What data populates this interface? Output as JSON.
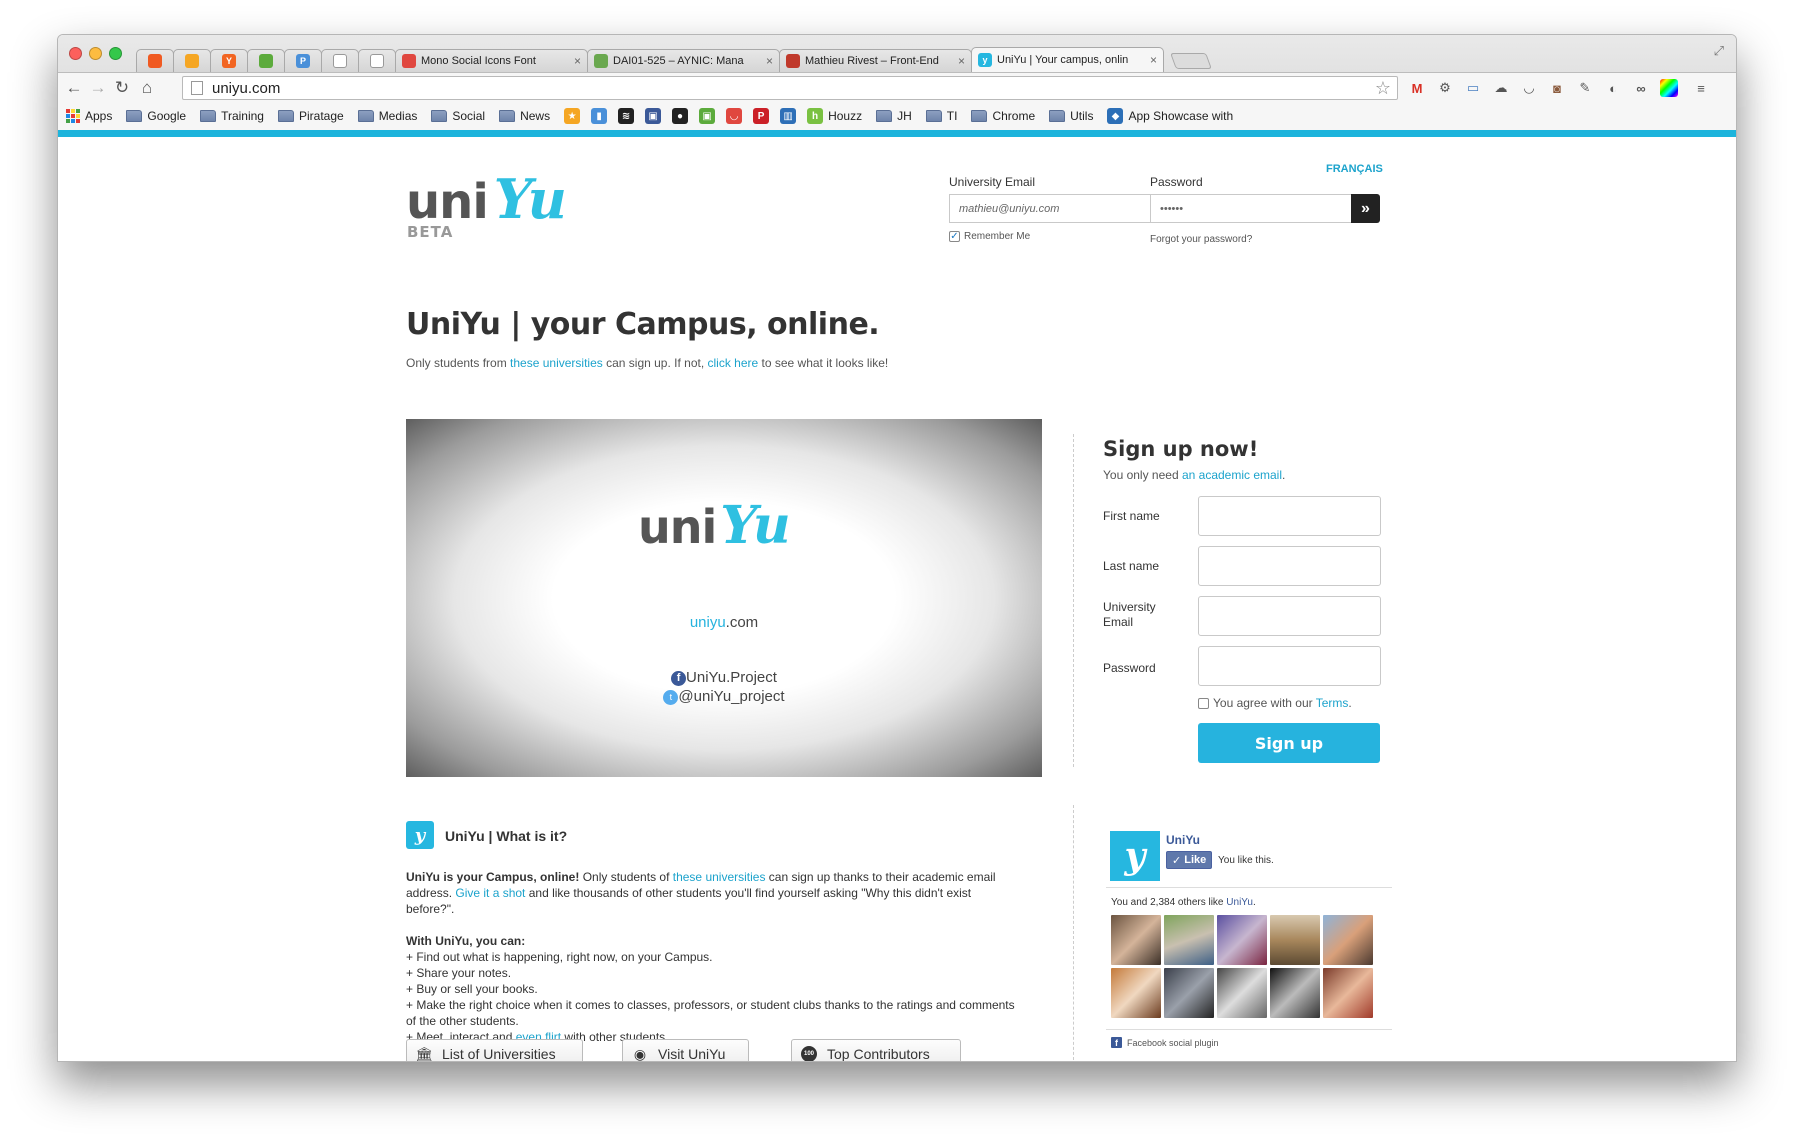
{
  "browser": {
    "tabs": [
      {
        "title": "",
        "favicon_color": "#f05a22",
        "favicon_glyph": ""
      },
      {
        "title": "",
        "favicon_color": "#f5a623",
        "favicon_glyph": ""
      },
      {
        "title": "",
        "favicon_color": "#f26522",
        "favicon_glyph": "Y"
      },
      {
        "title": "",
        "favicon_color": "#5cab3c",
        "favicon_glyph": ""
      },
      {
        "title": "",
        "favicon_color": "#4a90d9",
        "favicon_glyph": "P"
      },
      {
        "title": "",
        "favicon_color": "#ffffff",
        "favicon_glyph": ""
      },
      {
        "title": "",
        "favicon_color": "#ffffff",
        "favicon_glyph": ""
      },
      {
        "title": "Mono Social Icons Font",
        "favicon_color": "#e0473f",
        "favicon_glyph": ""
      },
      {
        "title": "DAI01-525 – AYNIC: Mana",
        "favicon_color": "#6aa84f",
        "favicon_glyph": ""
      },
      {
        "title": "Mathieu Rivest – Front-End",
        "favicon_color": "#c0392b",
        "favicon_glyph": ""
      },
      {
        "title": "UniYu | Your campus, onlin",
        "favicon_color": "#26b7e0",
        "favicon_glyph": "y"
      }
    ],
    "url": "uniyu.com",
    "bookmarks": {
      "apps": "Apps",
      "folders1": [
        "Google",
        "Training",
        "Piratage",
        "Medias",
        "Social",
        "News"
      ],
      "houzz": "Houzz",
      "folders2": [
        "JH",
        "TI",
        "Chrome",
        "Utils"
      ],
      "showcase": "App Showcase with"
    }
  },
  "header": {
    "logo_uni": "uni",
    "logo_yu": "Yu",
    "logo_beta": "BETA",
    "language_link": "FRANÇAIS",
    "login": {
      "email_label": "University Email",
      "email_value": "mathieu@uniyu.com",
      "password_label": "Password",
      "password_value": "••••••",
      "submit_icon": "»",
      "remember_label": "Remember Me",
      "forgot_link": "Forgot your password?"
    }
  },
  "hero": {
    "title": "UniYu | your Campus, online.",
    "subtitle_1": "Only students from ",
    "subtitle_link_1": "these universities",
    "subtitle_2": " can sign up. If not, ",
    "subtitle_link_2": "click here",
    "subtitle_3": " to see what it looks like!"
  },
  "video": {
    "logo_uni": "uni",
    "logo_yu": "Yu",
    "site_a": "uniyu",
    "site_b": ".com",
    "facebook": "UniYu.Project",
    "twitter": "@uniYu_project"
  },
  "signup": {
    "title": "Sign up now!",
    "sub_1": "You only need ",
    "sub_link": "an academic email",
    "sub_2": ".",
    "first_name_label": "First name",
    "last_name_label": "Last name",
    "email_label_1": "University",
    "email_label_2": "Email",
    "password_label": "Password",
    "agree_1": "You agree with our ",
    "agree_link": "Terms",
    "agree_2": ".",
    "button": "Sign up"
  },
  "about": {
    "icon": "y",
    "title": "UniYu | What is it?",
    "p1_bold": "UniYu is your Campus, online!",
    "p1_a": " Only students of ",
    "p1_link1": "these universities",
    "p1_b": " can sign up thanks to their academic email address. ",
    "p1_link2": "Give it a shot",
    "p1_c": " and like thousands of other students you'll find yourself asking \"Why this didn't exist before?\".",
    "list_title": "With UniYu, you can:",
    "items": [
      "+ Find out what is happening, right now, on your Campus.",
      "+ Share your notes.",
      "+ Buy or sell your books.",
      "+ Make the right choice when it comes to classes, professors, or student clubs thanks to the ratings and comments of the other students."
    ],
    "last_a": "+ Meet, interact and ",
    "last_link": "even flirt",
    "last_b": " with other students.",
    "buttons": [
      "List of Universities",
      "Visit UniYu",
      "Top Contributors"
    ]
  },
  "facebook_widget": {
    "logo": "y",
    "page_name": "UniYu",
    "like_button": "Like",
    "you_like": "You like this.",
    "count_text": "You and 2,384 others like ",
    "count_link": "UniYu",
    "count_end": ".",
    "plugin_label": "Facebook social plugin"
  },
  "colors": {
    "accent": "#26b3de",
    "link": "#1ca3cc",
    "facebook": "#3b5998"
  }
}
